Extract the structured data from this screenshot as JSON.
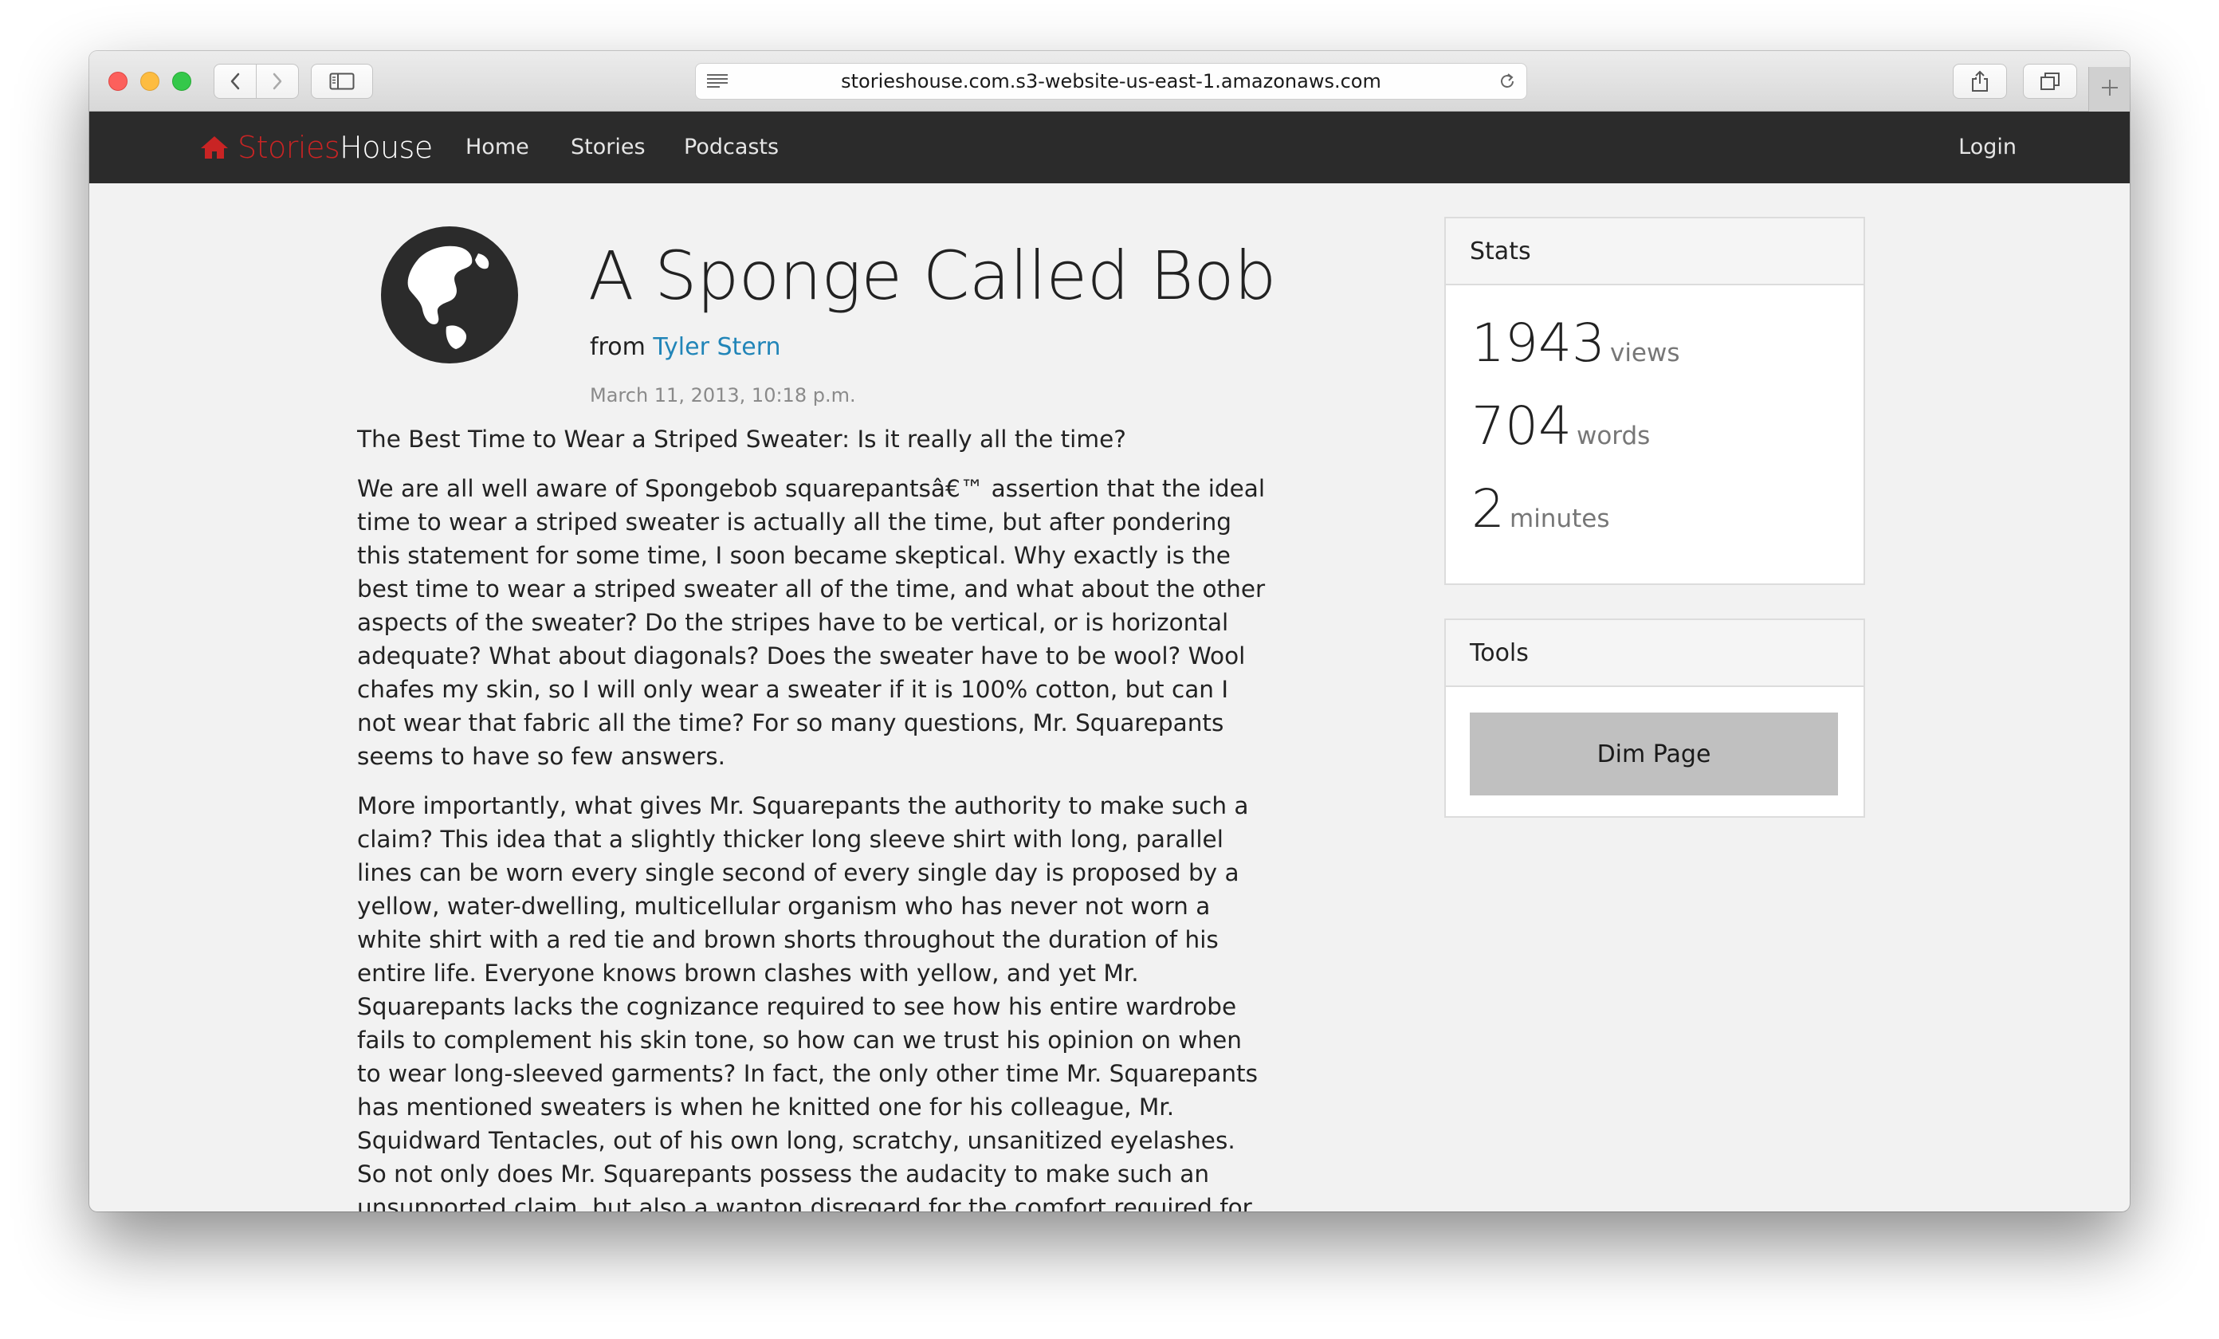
{
  "browser": {
    "url": "storieshouse.com.s3-website-us-east-1.amazonaws.com",
    "icons": [
      "back-icon",
      "forward-icon",
      "sidebar-icon",
      "reader-icon",
      "reload-icon",
      "share-icon",
      "tabs-icon",
      "plus-icon"
    ]
  },
  "nav": {
    "brand_part1": "Stories",
    "brand_part2": "House",
    "links": [
      "Home",
      "Stories",
      "Podcasts"
    ],
    "login": "Login",
    "colors": {
      "bar": "#2b2b2b",
      "brand_accent": "#c92424"
    }
  },
  "article": {
    "title": "A Sponge Called Bob",
    "from_label": "from",
    "author": "Tyler Stern",
    "date": "March 11, 2013, 10:18 p.m.",
    "paragraphs": [
      "The Best Time to Wear a Striped Sweater: Is it really all the time?",
      "We are all well aware of Spongebob squarepantsâ€™ assertion that the ideal time to wear a striped sweater is actually all the time, but after pondering this statement for some time, I soon became skeptical. Why exactly is the best time to wear a striped sweater all of the time, and what about the other aspects of the sweater? Do the stripes have to be vertical, or is horizontal adequate? What about diagonals? Does the sweater have to be wool? Wool chafes my skin, so I will only wear a sweater if it is 100% cotton, but can I not wear that fabric all the time? For so many questions, Mr. Squarepants seems to have so few answers.",
      "More importantly, what gives Mr. Squarepants the authority to make such a claim? This idea that a slightly thicker long sleeve shirt with long, parallel lines can be worn every single second of every single day is proposed by a yellow, water-dwelling, multicellular organism who has never not worn a white shirt with a red tie and brown shorts throughout the duration of his entire life. Everyone knows brown clashes with yellow, and yet Mr. Squarepants lacks the cognizance required to see how his entire wardrobe fails to complement his skin tone, so how can we trust his opinion on when to wear long-sleeved garments? In fact, the only other time Mr. Squarepants has mentioned sweaters is when he knitted one for his colleague, Mr. Squidward Tentacles, out of his own long, scratchy, unsanitized eyelashes. So not only does Mr. Squarepants possess the audacity to make such an unsupported claim, but also a wanton disregard for the comfort required for sweaters. In Spain, Mr. Squarepants is referred to as â€œEsponja de Bob con pantalones"
    ]
  },
  "stats": {
    "title": "Stats",
    "items": [
      {
        "value": "1943",
        "unit": "views"
      },
      {
        "value": "704",
        "unit": "words"
      },
      {
        "value": "2",
        "unit": "minutes"
      }
    ]
  },
  "tools": {
    "title": "Tools",
    "dim_button": "Dim Page"
  }
}
